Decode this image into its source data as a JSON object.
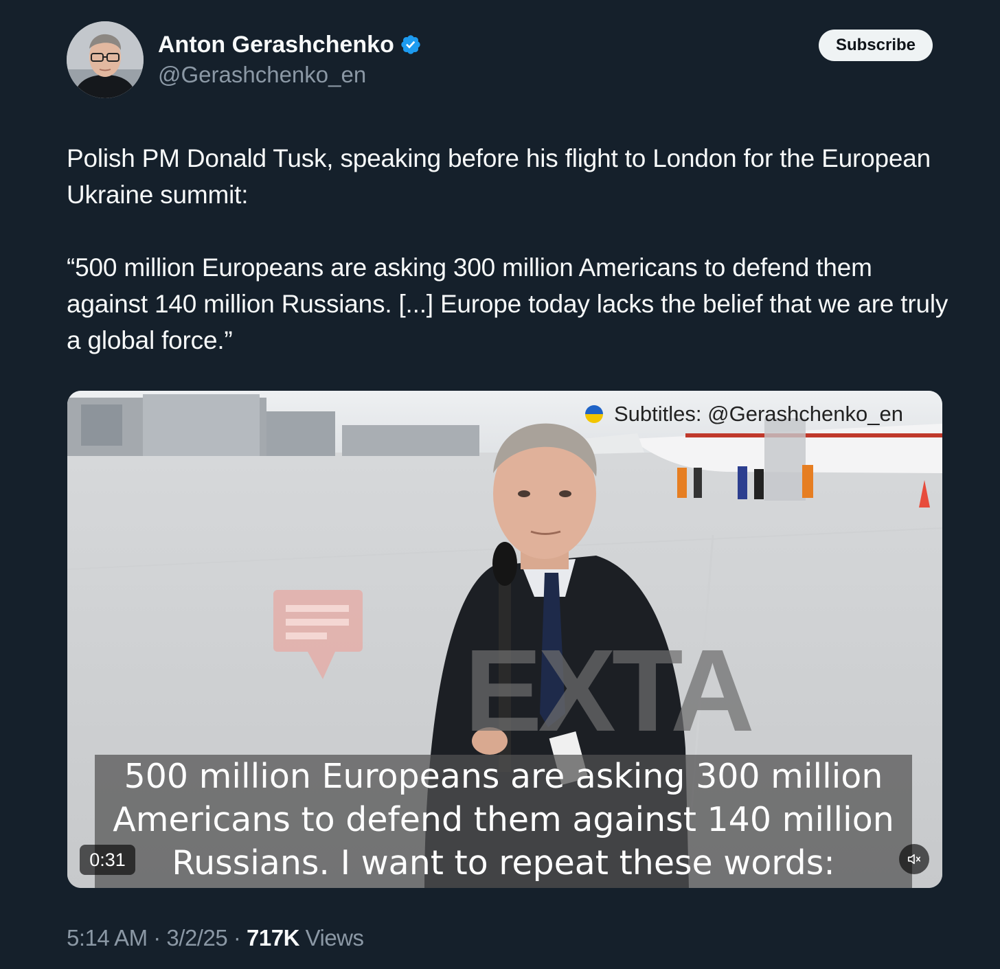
{
  "author": {
    "name": "Anton Gerashchenko",
    "handle": "@Gerashchenko_en",
    "verified": true
  },
  "subscribe_label": "Subscribe",
  "tweet": {
    "paragraph1": "Polish PM Donald Tusk, speaking before his flight to London for the European Ukraine summit:",
    "paragraph2": "“500 million Europeans are asking 300 million Americans to defend them against 140 million Russians. [...] Europe today lacks the belief that we are truly a global force.”"
  },
  "media": {
    "watermark": "Subtitles: @Gerashchenko_en",
    "logo_text": "EXTA",
    "subtitle_lines": [
      "500 million Europeans are asking 300 million",
      "Americans to defend them against 140 million",
      "Russians. I want to repeat these words:"
    ],
    "duration": "0:31",
    "muted": true
  },
  "meta": {
    "time": "5:14 AM",
    "date": "3/2/25",
    "separator": "·",
    "views_count": "717K",
    "views_label": "Views"
  },
  "colors": {
    "background": "#15202b",
    "verified_badge": "#1d9bf0",
    "secondary_text": "#8b98a5"
  }
}
